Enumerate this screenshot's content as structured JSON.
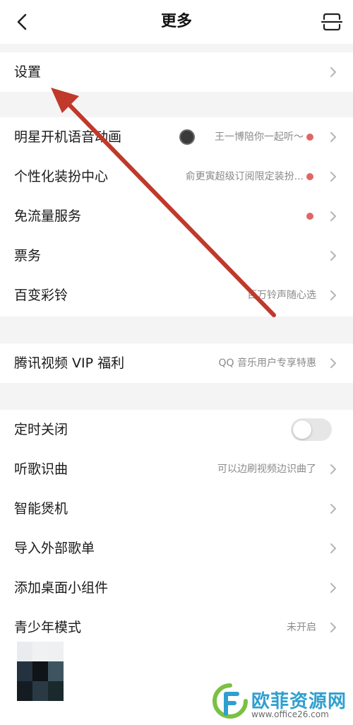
{
  "header": {
    "title": "更多",
    "back_icon": "chevron-left-icon",
    "scan_icon": "scan-icon"
  },
  "rows": {
    "settings": {
      "label": "设置"
    },
    "star_boot": {
      "label": "明星开机语音动画",
      "value": "王一博陪你一起听～",
      "has_dot": true
    },
    "personalize": {
      "label": "个性化装扮中心",
      "value": "俞更寅超级订阅限定装扮...",
      "has_dot": true
    },
    "free_data": {
      "label": "免流量服务",
      "has_dot": true
    },
    "tickets": {
      "label": "票务"
    },
    "ringtone": {
      "label": "百变彩铃",
      "value": "百万铃声随心选"
    },
    "tencent_vip": {
      "label": "腾讯视频 VIP 福利",
      "value": "QQ 音乐用户专享特惠"
    },
    "timer": {
      "label": "定时关闭",
      "toggle_on": false
    },
    "song_recognition": {
      "label": "听歌识曲",
      "value": "可以边刷视频边识曲了"
    },
    "smart_burn": {
      "label": "智能煲机"
    },
    "import_playlist": {
      "label": "导入外部歌单"
    },
    "desktop_widget": {
      "label": "添加桌面小组件"
    },
    "teen_mode": {
      "label": "青少年模式",
      "value": "未开启"
    }
  },
  "colors": {
    "dot": "#e06666",
    "annotation_arrow": "#c0392b",
    "watermark_blue": "#2f9fcf",
    "watermark_green": "#7ac142"
  },
  "watermark": {
    "text": "欧菲资源网",
    "url": "www.office26.com"
  }
}
